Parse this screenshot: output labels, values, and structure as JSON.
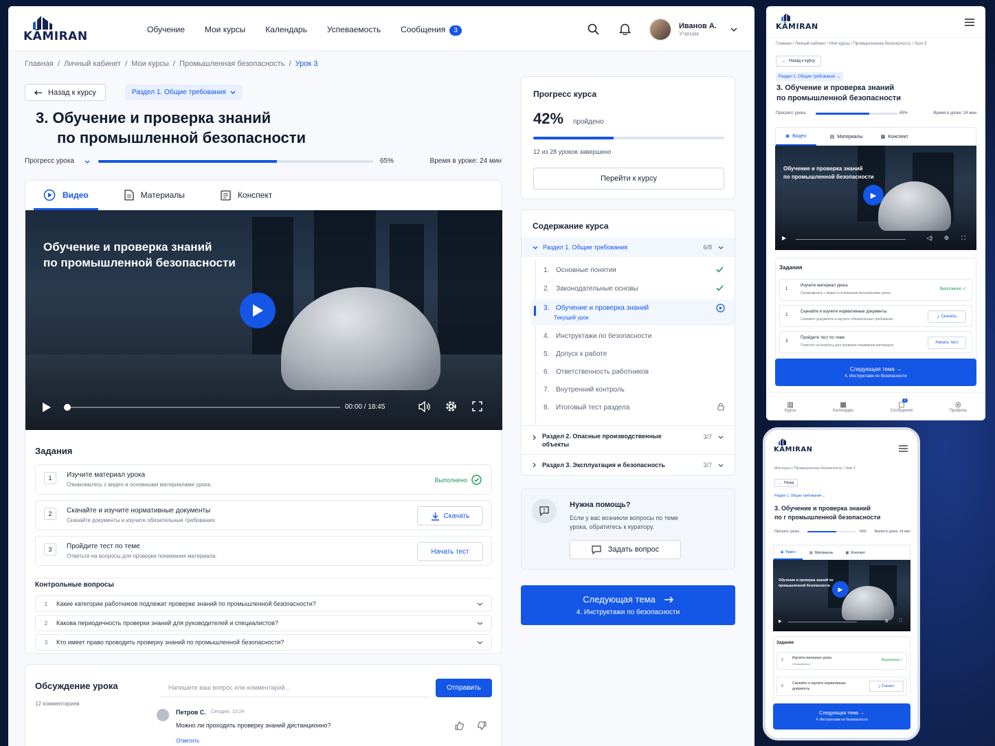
{
  "brand": "KĀMIRAN",
  "nav": [
    "Обучение",
    "Мои курсы",
    "Календарь",
    "Успеваемость",
    "Сообщения"
  ],
  "messages_count": "3",
  "user": {
    "name": "Иванов А.",
    "role": "Ученик"
  },
  "breadcrumbs": [
    "Главная",
    "Личный кабинет",
    "Мои курсы",
    "Промышленная безопасность"
  ],
  "breadcrumb_current": "Урок 3",
  "back_label": "Назад к курсу",
  "section_chip": "Раздел 1. Общие требования",
  "lesson": {
    "num": "3.",
    "title1": "Обучение и проверка знаний",
    "title2": "по промышленной безопасности"
  },
  "lesson_progress": {
    "label": "Прогресс урока",
    "value": 65,
    "text": "65%",
    "time": "Время в уроке: 24 мин"
  },
  "tabs": [
    "Видео",
    "Материалы",
    "Конспект"
  ],
  "video": {
    "title1": "Обучение и проверка знаний",
    "title2": "по промышленной безопасности",
    "time": "00:00 / 18:45"
  },
  "tasks": {
    "heading": "Задания",
    "items": [
      {
        "n": "1",
        "title": "Изучите материал урока",
        "sub": "Ознакомьтесь с видео и основными материалами урока.",
        "status": "Выполнено"
      },
      {
        "n": "2",
        "title": "Скачайте и изучите нормативные документы",
        "sub": "Скачайте документы и изучите обязательные требования.",
        "action": "Скачать"
      },
      {
        "n": "3",
        "title": "Пройдите тест по теме",
        "sub": "Ответьте на вопросы для проверки понимания материала.",
        "action": "Начать тест"
      }
    ]
  },
  "questions": {
    "heading": "Контрольные вопросы",
    "items": [
      {
        "n": "1",
        "text": "Какие категории работников подлежат проверке знаний по промышленной безопасности?"
      },
      {
        "n": "2",
        "text": "Какова периодичность проверки знаний для руководителей и специалистов?"
      },
      {
        "n": "3",
        "text": "Кто имеет право проводить проверку знаний по промышленной безопасности?"
      }
    ]
  },
  "discussion": {
    "heading": "Обсуждение урока",
    "count": "12 комментариев",
    "placeholder": "Напишите ваш вопрос или комментарий...",
    "send": "Отправить",
    "comment": {
      "author": "Петров С.",
      "time": "Сегодня, 10:24",
      "text": "Можно ли проходить проверку знаний дистанционно?",
      "reply": "Ответить"
    }
  },
  "course_progress": {
    "heading": "Прогресс курса",
    "value": 42,
    "percent": "42%",
    "passed": "пройдено",
    "done_text": "12 из 28 уроков завершено",
    "button": "Перейти к курсу"
  },
  "contents": {
    "heading": "Содержание курса",
    "section1": {
      "title": "Раздел 1. Общие требования",
      "count": "6/8"
    },
    "lessons": [
      {
        "n": "1.",
        "title": "Основные понятия",
        "state": "done"
      },
      {
        "n": "2.",
        "title": "Законодательные основы",
        "state": "done"
      },
      {
        "n": "3.",
        "title": "Обучение и проверка знаний",
        "state": "current",
        "sub": "Текущий урок"
      },
      {
        "n": "4.",
        "title": "Инструктажи по безопасности",
        "state": "todo"
      },
      {
        "n": "5.",
        "title": "Допуск к работе",
        "state": "todo"
      },
      {
        "n": "6.",
        "title": "Ответственность работников",
        "state": "todo"
      },
      {
        "n": "7.",
        "title": "Внутренний контроль",
        "state": "todo"
      },
      {
        "n": "8.",
        "title": "Итоговый тест раздела",
        "state": "locked"
      }
    ],
    "section2": {
      "title1": "Раздел 2. Опасные производственные",
      "title2": "объекты",
      "count": "3/7"
    },
    "section3": {
      "title": "Раздел 3. Эксплуатация и безопасность",
      "count": "3/7"
    }
  },
  "help": {
    "heading": "Нужна помощь?",
    "text1": "Если у вас возникли вопросы по теме",
    "text2": "урока, обратитесь к куратору.",
    "button": "Задать вопрос"
  },
  "next": {
    "label": "Следующая тема",
    "sub": "4. Инструктажи по безопасности"
  },
  "tablet": {
    "back": "Назад к курсу",
    "progress_label": "Прогресс урока",
    "progress_text": "65%",
    "progress_value": 65,
    "time": "Время в уроке: 24 мин",
    "bottom_nav": [
      "Курсы",
      "Календарь",
      "Сообщения",
      "Профиль"
    ]
  },
  "mobile": {
    "crumbs": "Мои курсы / Промышленная безопасность / Урок 3",
    "back": "Назад",
    "title1": "3. Обучение и проверка знаний",
    "title2": "по г промышленной безопасности",
    "progress_text": "60%",
    "progress_value": 60,
    "time": "Время в уроке: 24 мин",
    "video_title": "Обучение и проверка знаний по промышленной безопасности",
    "task1_sub": "Ознакомьтесь",
    "task2_title1": "Скачайте и изучите нормативные",
    "task2_title2": "документы"
  },
  "colors": {
    "accent": "#1456e6",
    "success": "#1a9a54",
    "dark": "#101a2e"
  }
}
